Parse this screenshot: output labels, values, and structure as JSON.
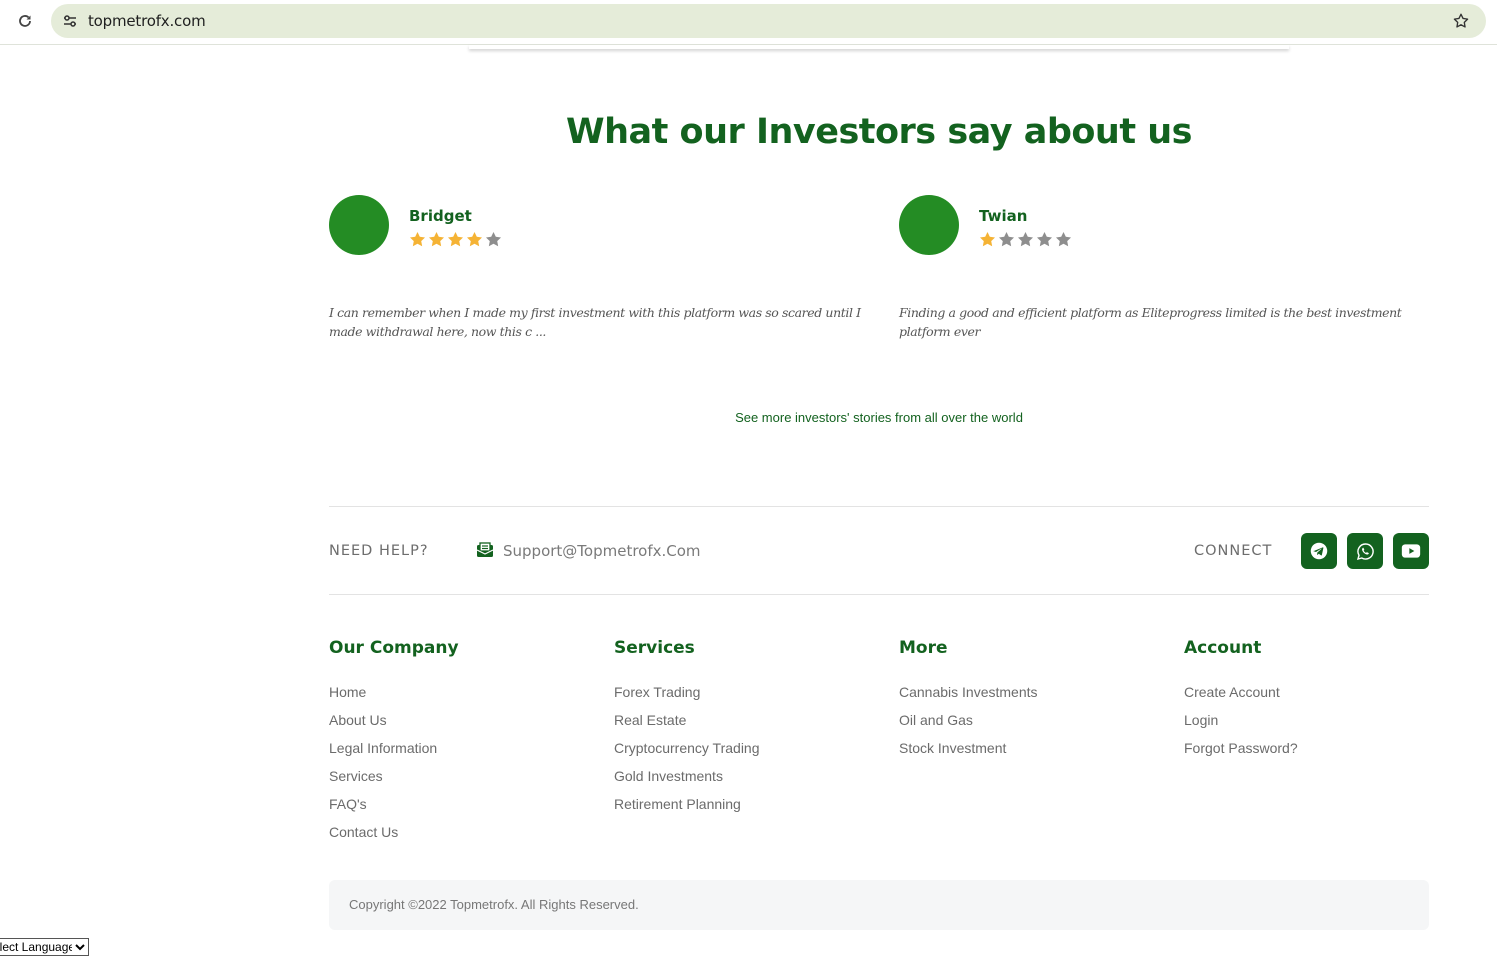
{
  "browser": {
    "url": "topmetrofx.com",
    "reload_icon": "reload-icon",
    "site_info_icon": "tune-icon",
    "bookmark_icon": "star-icon"
  },
  "testimonials": {
    "heading": "What our Investors say about us",
    "items": [
      {
        "name": "Bridget",
        "rating": 4,
        "max_rating": 5,
        "text": "I can remember when I made my first investment with this platform was so scared until I made withdrawal here, now this c ..."
      },
      {
        "name": "Twian",
        "rating": 1,
        "max_rating": 5,
        "text": "Finding a good and efficient platform as Eliteprogress limited is the best investment platform ever"
      }
    ],
    "see_more": "See more investors' stories from all over the world"
  },
  "help": {
    "need_help": "NEED HELP?",
    "email": "Support@Topmetrofx.Com",
    "connect": "CONNECT",
    "socials": [
      "telegram-icon",
      "whatsapp-icon",
      "youtube-icon"
    ]
  },
  "footer": {
    "columns": [
      {
        "title": "Our Company",
        "links": [
          "Home",
          "About Us",
          "Legal Information",
          "Services",
          "FAQ's",
          "Contact Us"
        ]
      },
      {
        "title": "Services",
        "links": [
          "Forex Trading",
          "Real Estate",
          "Cryptocurrency Trading",
          "Gold Investments",
          "Retirement Planning"
        ]
      },
      {
        "title": "More",
        "links": [
          "Cannabis Investments",
          "Oil and Gas",
          "Stock Investment"
        ]
      },
      {
        "title": "Account",
        "links": [
          "Create Account",
          "Login",
          "Forgot Password?"
        ]
      }
    ],
    "copyright": "Copyright ©2022 Topmetrofx. All Rights Reserved."
  },
  "language_select": {
    "selected": "Select Language"
  },
  "colors": {
    "brand_green": "#13621f",
    "avatar_green": "#248c24",
    "star_gold": "#f5b335",
    "star_gray": "#8e8e8e"
  }
}
